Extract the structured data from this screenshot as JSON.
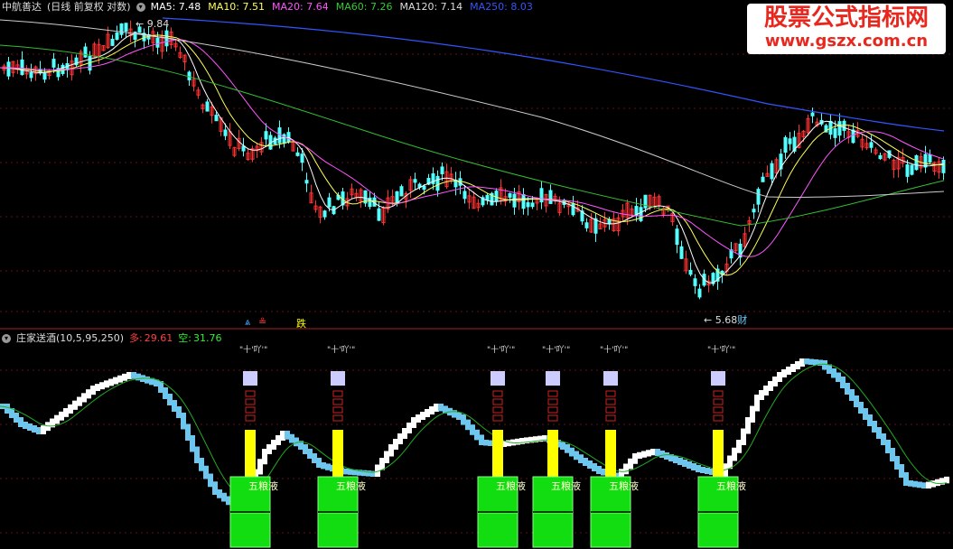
{
  "main_panel": {
    "title": "中航善达",
    "mode": "(日线 前复权 对数)",
    "indicators": [
      {
        "name": "MA5",
        "value": "7.48",
        "color": "#ffffff"
      },
      {
        "name": "MA10",
        "value": "7.51",
        "color": "#ffff55"
      },
      {
        "name": "MA20",
        "value": "7.64",
        "color": "#ff55ff"
      },
      {
        "name": "MA60",
        "value": "7.26",
        "color": "#33cc33"
      },
      {
        "name": "MA120",
        "value": "7.14",
        "color": "#dddddd"
      },
      {
        "name": "MA250",
        "value": "8.03",
        "color": "#3355ff"
      }
    ],
    "high_marker": "9.84",
    "low_marker": "5.68",
    "low_marker_tag": "财",
    "signal_label": "跌"
  },
  "sub_panel": {
    "title": "庄家送酒",
    "params": "(10,5,95,250)",
    "long_label": "多:",
    "long_value": "29.61",
    "short_label": "空:",
    "short_value": "31.76",
    "top_glyph": "\"十'吖'\"",
    "block_label": "五粮液",
    "signal_count": 6
  },
  "watermark": {
    "line1": "股票公式指标网",
    "line2": "www.gszx.com.cn"
  },
  "colors": {
    "up": "#ff3232",
    "down": "#54ffff",
    "signal_yellow": "#ffff00",
    "signal_green": "#11dd11",
    "lavender": "#ccccff",
    "k_line_light": "#6cc6ee",
    "k_line_white": "#ffffff",
    "d_line": "#22aa22"
  }
}
